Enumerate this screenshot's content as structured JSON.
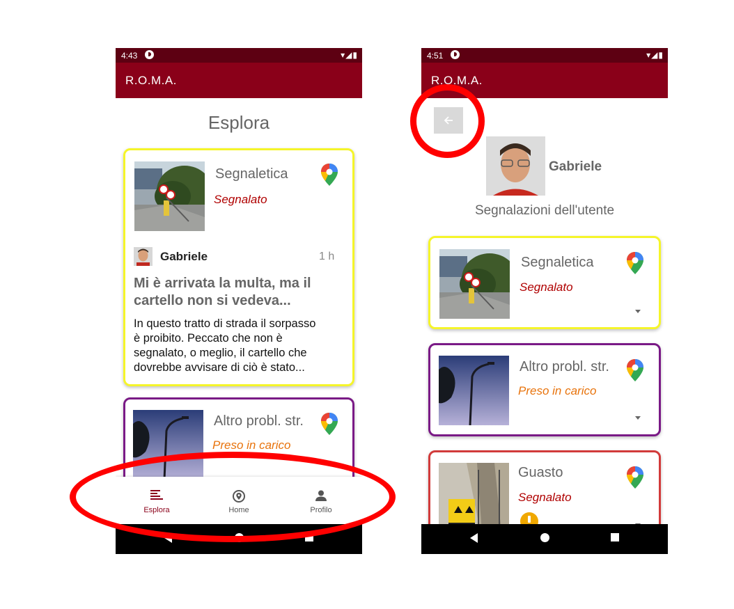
{
  "left": {
    "status_time": "4:43",
    "status_right": "▾◢▮",
    "app_title": "R.O.M.A.",
    "page_title": "Esplora",
    "card1": {
      "category": "Segnaletica",
      "status": "Segnalato",
      "user": "Gabriele",
      "time_ago": "1 h",
      "title_line1": "Mi è arrivata la multa, ma il",
      "title_line2": "cartello non si vedeva...",
      "body_lines": [
        "In questo tratto di strada il sorpasso",
        "è proibito. Peccato che non è",
        "segnalato, o meglio, il cartello che",
        "dovrebbe avvisare di ciò è stato..."
      ]
    },
    "card2": {
      "category": "Altro probl. str.",
      "status": "Preso in carico"
    },
    "bottom_nav": [
      {
        "label": "Esplora",
        "icon": "list-icon",
        "active": true
      },
      {
        "label": "Home",
        "icon": "location-icon",
        "active": false
      },
      {
        "label": "Profilo",
        "icon": "person-icon",
        "active": false
      }
    ]
  },
  "right": {
    "status_time": "4:51",
    "status_right": "▾◢▮",
    "app_title": "R.O.M.A.",
    "user_name": "Gabriele",
    "section_title": "Segnalazioni dell'utente",
    "cards": [
      {
        "category": "Segnaletica",
        "status": "Segnalato"
      },
      {
        "category": "Altro probl. str.",
        "status": "Preso in carico"
      },
      {
        "category": "Guasto",
        "status": "Segnalato"
      }
    ]
  },
  "colors": {
    "appbar": "#8a0019",
    "statusbar": "#5d0012",
    "border_yellow": "#f5f52a",
    "border_purple": "#7a1a86",
    "border_red": "#d23b3b",
    "status_red": "#b00000",
    "status_orange": "#e8730c",
    "nav_active": "#8a0019",
    "annotation": "#ff0000"
  }
}
